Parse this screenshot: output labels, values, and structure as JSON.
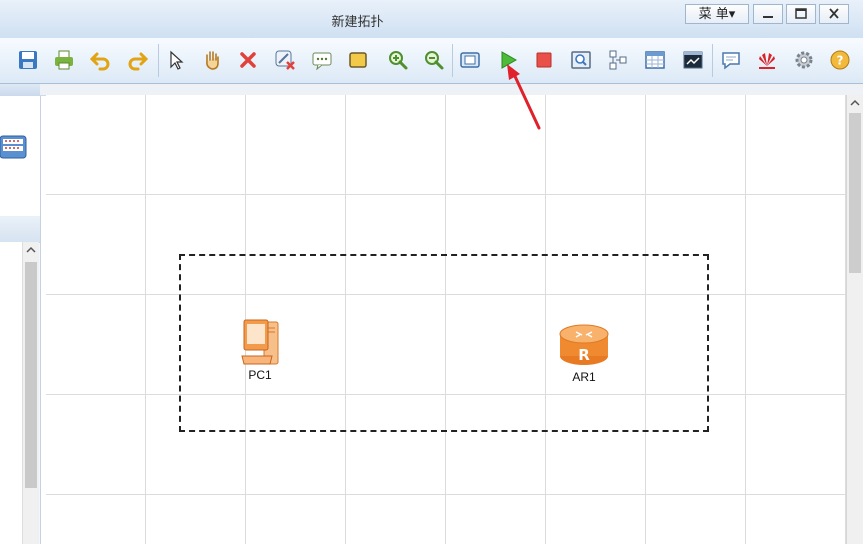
{
  "window": {
    "title": "新建拓扑",
    "menu_label": "菜 单▾"
  },
  "toolbar": {
    "buttons": [
      {
        "name": "save-icon"
      },
      {
        "name": "print-icon"
      },
      {
        "name": "undo-icon"
      },
      {
        "name": "redo-icon"
      },
      {
        "name": "select-pointer-icon"
      },
      {
        "name": "pan-hand-icon"
      },
      {
        "name": "delete-icon"
      },
      {
        "name": "delete-link-icon"
      },
      {
        "name": "text-comment-icon"
      },
      {
        "name": "rectangle-icon"
      },
      {
        "name": "zoom-in-icon"
      },
      {
        "name": "zoom-out-icon"
      },
      {
        "name": "fit-view-icon"
      },
      {
        "name": "start-device-icon"
      },
      {
        "name": "stop-device-icon"
      },
      {
        "name": "capture-icon"
      },
      {
        "name": "topology-icon"
      },
      {
        "name": "table-icon"
      },
      {
        "name": "terminal-icon"
      },
      {
        "name": "chat-icon"
      },
      {
        "name": "huawei-logo-icon"
      },
      {
        "name": "settings-gear-icon"
      },
      {
        "name": "help-icon"
      }
    ]
  },
  "devices": [
    {
      "label": "PC1",
      "type": "pc"
    },
    {
      "label": "AR1",
      "type": "router"
    }
  ],
  "colors": {
    "annotation_arrow": "#e0202a",
    "device_orange": "#f08a30"
  }
}
